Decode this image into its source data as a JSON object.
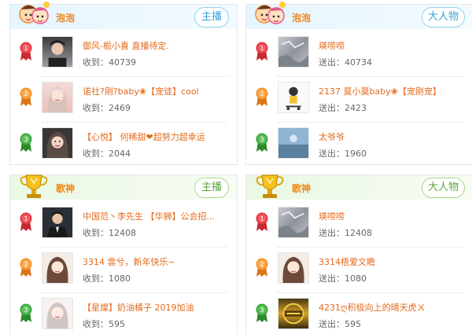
{
  "colors": {
    "accent_orange": "#e46a1c",
    "blue_header": "#e4f5fd",
    "green_header": "#e9f8e3",
    "rank1": "#e8343c",
    "rank2": "#f5922a",
    "rank3": "#3aa83a"
  },
  "panels": [
    {
      "title": "泡泡",
      "tag": "主播",
      "icon": "kids-mascot-icon",
      "theme": "blue",
      "rows": [
        {
          "rank": "1",
          "name": "御风-栀小喜 直播待定.",
          "meta_label": "收到：",
          "meta_value": "40739",
          "avatar": "male-portrait"
        },
        {
          "rank": "2",
          "name": "诺社?刚?baby❀【宠徒】cool",
          "meta_label": "收到：",
          "meta_value": "2469",
          "avatar": "female-portrait"
        },
        {
          "rank": "3",
          "name": "【心悦】 何稀甜❤超努力超幸运",
          "meta_label": "收到：",
          "meta_value": "2044",
          "avatar": "female-portrait-dark"
        }
      ]
    },
    {
      "title": "泡泡",
      "tag": "大人物",
      "icon": "kids-mascot-icon",
      "theme": "blue",
      "rows": [
        {
          "rank": "1",
          "name": "瑛唠唠",
          "meta_label": "送出：",
          "meta_value": "40734",
          "avatar": "gray-texture"
        },
        {
          "rank": "2",
          "name": "2137 莫小莫baby❀【宠刚宠】",
          "meta_label": "送出：",
          "meta_value": "2423",
          "avatar": "cartoon-skater"
        },
        {
          "rank": "3",
          "name": "太爷爷",
          "meta_label": "送出：",
          "meta_value": "1960",
          "avatar": "blue-photo"
        }
      ]
    },
    {
      "title": "歌神",
      "tag": "主播",
      "icon": "trophy-icon",
      "theme": "green",
      "rows": [
        {
          "rank": "1",
          "name": "中国范丶李先生 【华狮】公会招...",
          "meta_label": "收到：",
          "meta_value": "12408",
          "avatar": "male-suit"
        },
        {
          "rank": "2",
          "name": "3314 雲兮，新年快乐~",
          "meta_label": "收到：",
          "meta_value": "1080",
          "avatar": "female-light"
        },
        {
          "rank": "3",
          "name": "【星燦】奶油橘子 2019加油",
          "meta_label": "收到：",
          "meta_value": "595",
          "avatar": "female-pale"
        }
      ]
    },
    {
      "title": "歌神",
      "tag": "大人物",
      "icon": "trophy-icon",
      "theme": "green",
      "rows": [
        {
          "rank": "1",
          "name": "瑛唠唠",
          "meta_label": "送出：",
          "meta_value": "12408",
          "avatar": "gray-texture"
        },
        {
          "rank": "2",
          "name": "3314梧爱文瞻",
          "meta_label": "送出：",
          "meta_value": "1080",
          "avatar": "female-light"
        },
        {
          "rank": "3",
          "name": "4231ღ积极向上的晴天虎ㄨ",
          "meta_label": "送出：",
          "meta_value": "595",
          "avatar": "gold-badge"
        }
      ]
    }
  ]
}
